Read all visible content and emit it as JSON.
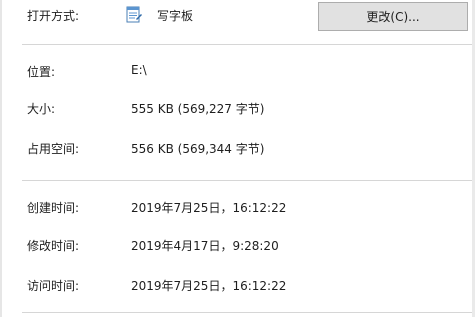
{
  "open_with": {
    "label": "打开方式:",
    "app_name": "写字板",
    "app_icon": "wordpad-icon",
    "change_button": "更改(C)..."
  },
  "location": {
    "label": "位置:",
    "value": "E:\\"
  },
  "size": {
    "label": "大小:",
    "value": "555 KB (569,227 字节)"
  },
  "size_on_disk": {
    "label": "占用空间:",
    "value": "556 KB (569,344 字节)"
  },
  "created": {
    "label": "创建时间:",
    "value": "2019年7月25日，16:12:22"
  },
  "modified": {
    "label": "修改时间:",
    "value": "2019年4月17日，9:28:20"
  },
  "accessed": {
    "label": "访问时间:",
    "value": "2019年7月25日，16:12:22"
  },
  "colors": {
    "button_bg": "#e1e1e1",
    "button_border": "#adadad",
    "divider": "#d6d6d6",
    "text": "#1e1e1e"
  }
}
